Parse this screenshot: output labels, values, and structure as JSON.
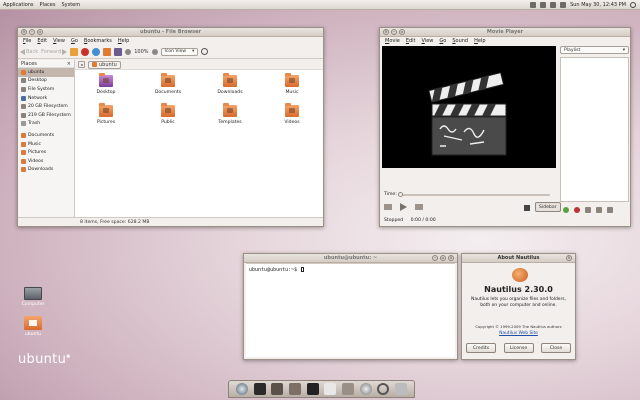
{
  "top_panel": {
    "menus": [
      "Applications",
      "Places",
      "System"
    ],
    "clock": "Sun May 30, 12:43 PM",
    "tray_icons": [
      "bluetooth-icon",
      "network-icon",
      "mail-icon",
      "volume-icon",
      "power-icon"
    ]
  },
  "file_browser": {
    "title": "ubuntu - File Browser",
    "menu": [
      "File",
      "Edit",
      "View",
      "Go",
      "Bookmarks",
      "Help"
    ],
    "toolbar": {
      "back": "Back",
      "forward": "Forward",
      "zoom": "100%",
      "view_mode": "Icon View"
    },
    "sidebar_header": "Places",
    "places": [
      "ubuntu",
      "Desktop",
      "File System",
      "Network",
      "20 GB Filesystem",
      "219 GB Filesystem",
      "Trash",
      "Documents",
      "Music",
      "Pictures",
      "Videos",
      "Downloads"
    ],
    "path": "ubuntu",
    "folders": [
      "Desktop",
      "Documents",
      "Downloads",
      "Music",
      "Pictures",
      "Public",
      "Templates",
      "Videos"
    ],
    "status": "8 items, Free space: 628.2 MB"
  },
  "movie_player": {
    "title": "Movie Player",
    "menu": [
      "Movie",
      "Edit",
      "View",
      "Go",
      "Sound",
      "Help"
    ],
    "playlist_select": "Playlist",
    "time_label": "Time:",
    "sidebar_button": "Sidebar",
    "status": "Stopped",
    "position": "0:00 / 0:00"
  },
  "terminal": {
    "title": "ubuntu@ubuntu: ~",
    "prompt": "ubuntu@ubuntu:~$"
  },
  "about_dialog": {
    "title": "About Nautilus",
    "app_name": "Nautilus 2.30.0",
    "description": "Nautilus lets you organize files and folders, both on your computer and online.",
    "copyright": "Copyright © 1999-2009 The Nautilus authors",
    "website": "Nautilus Web Site",
    "buttons": {
      "credits": "Credits",
      "license": "License",
      "close": "Close"
    }
  },
  "desktop": {
    "icons": [
      "Computer",
      "ubuntu"
    ],
    "logo": "ubuntu"
  },
  "colors": {
    "accent": "#e0783a",
    "selection": "#c3b6ad",
    "desktop_base": "#cfb3bf"
  }
}
